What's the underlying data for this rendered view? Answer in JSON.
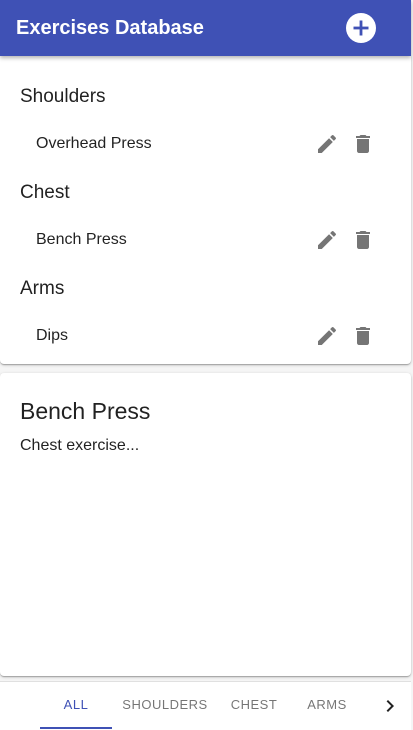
{
  "appbar": {
    "title": "Exercises Database",
    "add_icon": "add-circle-icon"
  },
  "groups": [
    {
      "title": "Shoulders",
      "items": [
        {
          "label": "Overhead Press"
        }
      ]
    },
    {
      "title": "Chest",
      "items": [
        {
          "label": "Bench Press"
        }
      ]
    },
    {
      "title": "Arms",
      "items": [
        {
          "label": "Dips"
        }
      ]
    }
  ],
  "item_actions": {
    "edit_icon": "pencil-icon",
    "delete_icon": "trash-icon"
  },
  "detail": {
    "title": "Bench Press",
    "description": "Chest exercise..."
  },
  "tabs": [
    {
      "label": "ALL",
      "active": true
    },
    {
      "label": "SHOULDERS",
      "active": false
    },
    {
      "label": "CHEST",
      "active": false
    },
    {
      "label": "ARMS",
      "active": false
    }
  ],
  "tab_scroll_icon": "chevron-right-icon",
  "colors": {
    "primary": "#3f51b5",
    "icon_gray": "#757575"
  }
}
